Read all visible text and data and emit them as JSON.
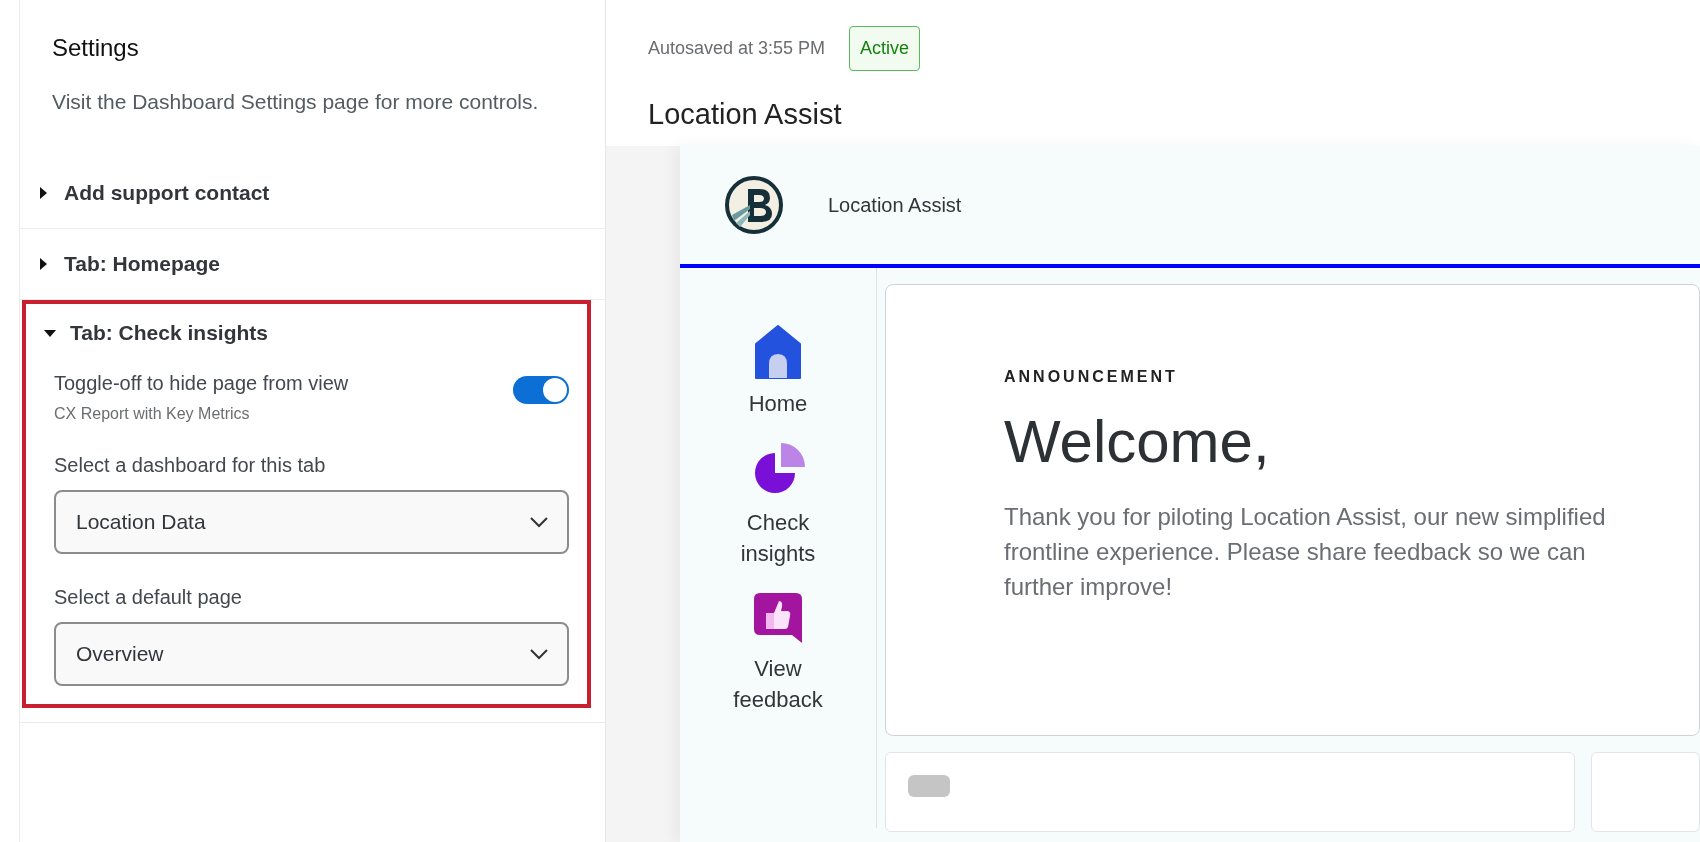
{
  "settings": {
    "title": "Settings",
    "description": "Visit the Dashboard Settings page for more controls.",
    "sections": [
      {
        "label": "Add support contact",
        "expanded": false,
        "highlighted": false
      },
      {
        "label": "Tab: Homepage",
        "expanded": false,
        "highlighted": false
      },
      {
        "label": "Tab: Check insights",
        "expanded": true,
        "highlighted": true,
        "toggle": {
          "label": "Toggle-off to hide page from view",
          "sublabel": "CX Report with Key Metrics",
          "on": true
        },
        "selects": [
          {
            "label": "Select a dashboard for this tab",
            "value": "Location Data"
          },
          {
            "label": "Select a default page",
            "value": "Overview"
          }
        ]
      }
    ]
  },
  "header": {
    "autosave": "Autosaved at 3:55 PM",
    "status": "Active"
  },
  "title": "Location Assist",
  "preview": {
    "app_name": "Location Assist",
    "nav": [
      {
        "kind": "home",
        "label": "Home"
      },
      {
        "kind": "insights",
        "label": "Check insights"
      },
      {
        "kind": "feedback",
        "label": "View feedback"
      }
    ],
    "announcement": {
      "eyebrow": "ANNOUNCEMENT",
      "heading": "Welcome,",
      "body": "Thank you for piloting Location Assist, our new simplified frontline experience. Please share feedback so we can further improve!"
    }
  }
}
